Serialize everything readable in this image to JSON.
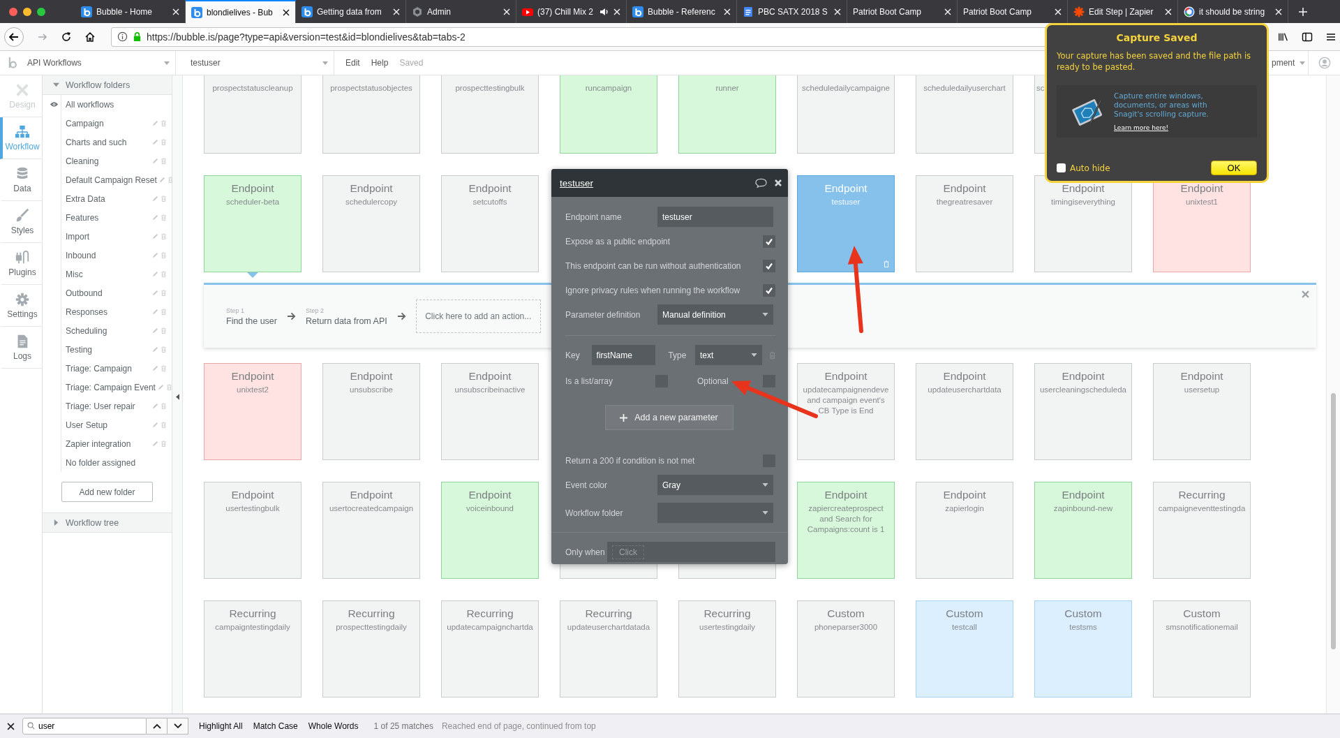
{
  "tabs": [
    {
      "title": "Bubble - Home",
      "selected": false,
      "audio": false
    },
    {
      "title": "blondielives - Bub",
      "selected": true,
      "audio": false
    },
    {
      "title": "Getting data from",
      "selected": false,
      "audio": false
    },
    {
      "title": "Admin",
      "selected": false,
      "audio": false
    },
    {
      "title": "(37) Chill Mix 2",
      "selected": false,
      "audio": true
    },
    {
      "title": "Bubble - Referenc",
      "selected": false,
      "audio": false
    },
    {
      "title": "PBC SATX 2018 S",
      "selected": false,
      "audio": false
    },
    {
      "title": "Patriot Boot Camp",
      "selected": false,
      "audio": false
    },
    {
      "title": "Patriot Boot Camp",
      "selected": false,
      "audio": false
    },
    {
      "title": "Edit Step | Zapier",
      "selected": false,
      "audio": false
    },
    {
      "title": "it should be string",
      "selected": false,
      "audio": false
    }
  ],
  "address_bar": {
    "url": "https://bubble.is/page?type=api&version=test&id=blondielives&tab=tabs-2"
  },
  "editor_toolbar": {
    "page_selector": "API Workflows",
    "workflow_selector": "testuser",
    "menu": [
      "Edit",
      "Help"
    ],
    "save_status": "Saved",
    "mode_selector": "pment"
  },
  "sidebar": {
    "items": [
      {
        "label": "Design",
        "selected": false,
        "disabled": true
      },
      {
        "label": "Workflow",
        "selected": true,
        "disabled": false
      },
      {
        "label": "Data",
        "selected": false,
        "disabled": false
      },
      {
        "label": "Styles",
        "selected": false,
        "disabled": false
      },
      {
        "label": "Plugins",
        "selected": false,
        "disabled": false
      },
      {
        "label": "Settings",
        "selected": false,
        "disabled": false
      },
      {
        "label": "Logs",
        "selected": false,
        "disabled": false
      }
    ]
  },
  "folders": {
    "title": "Workflow folders",
    "expanded": true,
    "items": [
      {
        "label": "All workflows",
        "kind": "all"
      },
      {
        "label": "Campaign",
        "kind": "folder"
      },
      {
        "label": "Charts and such",
        "kind": "folder"
      },
      {
        "label": "Cleaning",
        "kind": "folder"
      },
      {
        "label": "Default Campaign Reset",
        "kind": "folder"
      },
      {
        "label": "Extra Data",
        "kind": "folder"
      },
      {
        "label": "Features",
        "kind": "folder"
      },
      {
        "label": "Import",
        "kind": "folder"
      },
      {
        "label": "Inbound",
        "kind": "folder"
      },
      {
        "label": "Misc",
        "kind": "folder"
      },
      {
        "label": "Outbound",
        "kind": "folder"
      },
      {
        "label": "Responses",
        "kind": "folder"
      },
      {
        "label": "Scheduling",
        "kind": "folder"
      },
      {
        "label": "Testing",
        "kind": "folder"
      },
      {
        "label": "Triage: Campaign",
        "kind": "folder"
      },
      {
        "label": "Triage: Campaign Event",
        "kind": "folder"
      },
      {
        "label": "Triage: User repair",
        "kind": "folder"
      },
      {
        "label": "User Setup",
        "kind": "folder"
      },
      {
        "label": "Zapier integration",
        "kind": "folder"
      },
      {
        "label": "No folder assigned",
        "kind": "none"
      }
    ],
    "add_button": "Add new folder",
    "tree": {
      "title": "Workflow tree",
      "expanded": false
    }
  },
  "grid_top": [
    {
      "cards": [
        {
          "name": "prospectstatuscleanup",
          "color": "#f2f3f3",
          "selected": false
        },
        {
          "name": "prospectstatusobjectes",
          "color": "#f2f3f3",
          "selected": false
        },
        {
          "name": "prospecttestingbulk",
          "color": "#f2f3f3",
          "selected": false
        },
        {
          "name": "runcampaign",
          "color": "#d7f8db",
          "selected": false
        },
        {
          "name": "runner",
          "color": "#d7f8db",
          "selected": false
        },
        {
          "name": "scheduledailycampaigne",
          "color": "#f2f3f3",
          "selected": false
        },
        {
          "name": "scheduledailyuserchart",
          "color": "#f2f3f3",
          "selected": false
        },
        {
          "name": "sc",
          "color": "#f2f3f3",
          "selected": false
        }
      ]
    },
    {
      "cards": [
        {
          "type": "Endpoint",
          "name": "scheduler-beta",
          "color": "#d7f8db",
          "selected": false
        },
        {
          "type": "Endpoint",
          "name": "schedulercopy",
          "color": "#f2f3f3",
          "selected": false
        },
        {
          "type": "Endpoint",
          "name": "setcutoffs",
          "color": "#f2f3f3",
          "selected": false
        },
        {
          "type": "Endpoint",
          "name": "testuser",
          "selected": true
        },
        {
          "type": "Endpoint",
          "name": "thegreatresaver",
          "color": "#f2f3f3",
          "selected": false
        },
        {
          "type": "Endpoint",
          "name": "timingiseverything",
          "color": "#f2f3f3",
          "selected": false
        },
        {
          "type": "Endpoint",
          "name": "unixtest1",
          "color": "#ffe3e3",
          "selected": false
        }
      ]
    }
  ],
  "selected_workflow": {
    "steps": [
      {
        "number": "Step 1",
        "action": "Find the user"
      },
      {
        "number": "Step 2",
        "action": "Return data from API"
      }
    ],
    "add_action": "Click here to add an action..."
  },
  "grid_bottom": [
    {
      "cards": [
        {
          "type": "Endpoint",
          "name": "unixtest2",
          "color": "#ffe3e3",
          "selected": false
        },
        {
          "type": "Endpoint",
          "name": "unsubscribe",
          "color": "#f2f3f3",
          "selected": false
        },
        {
          "type": "Endpoint",
          "name": "unsubscribeinactive",
          "color": "#f2f3f3",
          "selected": false
        },
        {
          "type": "Endpoint",
          "name": "updatecampaignendeve",
          "condition_lines": [
            "and campaign event's",
            "CB Type is End"
          ],
          "color": "#f2f3f3",
          "selected": false
        },
        {
          "type": "Endpoint",
          "name": "updateuserchartdata",
          "color": "#f2f3f3",
          "selected": false
        },
        {
          "type": "Endpoint",
          "name": "usercleaningscheduleda",
          "color": "#f2f3f3",
          "selected": false
        },
        {
          "type": "Endpoint",
          "name": "usersetup",
          "color": "#f2f3f3",
          "selected": false
        }
      ]
    },
    {
      "cards": [
        {
          "type": "Endpoint",
          "name": "usertestingbulk",
          "color": "#f2f3f3",
          "selected": false
        },
        {
          "type": "Endpoint",
          "name": "usertocreatedcampaign",
          "color": "#f2f3f3",
          "selected": false
        },
        {
          "type": "Endpoint",
          "name": "voiceinbound",
          "color": "#d7f8db",
          "selected": false
        },
        {
          "color": "#f2f3f3",
          "selected": false
        },
        {
          "color": "#f2f3f3",
          "selected": false
        },
        {
          "type": "Endpoint",
          "name": "zapiercreateprospect",
          "condition_lines": [
            "and Search for",
            "Campaigns:count is 1"
          ],
          "color": "#d7f8db",
          "selected": false
        },
        {
          "type": "Endpoint",
          "name": "zapierlogin",
          "color": "#f2f3f3",
          "selected": false
        },
        {
          "type": "Endpoint",
          "name": "zapinbound-new",
          "color": "#d7f8db",
          "selected": false
        },
        {
          "type": "Recurring",
          "name": "campaigneventtestingda",
          "color": "#f2f3f3",
          "selected": false
        }
      ]
    },
    {
      "cards": [
        {
          "type": "Recurring",
          "name": "campaigntestingdaily",
          "color": "#f2f3f3",
          "selected": false
        },
        {
          "type": "Recurring",
          "name": "prospecttestingdaily",
          "color": "#f2f3f3",
          "selected": false
        },
        {
          "type": "Recurring",
          "name": "updatecampaignchartda",
          "color": "#f2f3f3",
          "selected": false
        },
        {
          "type": "Recurring",
          "name": "updateuserchartdatada",
          "color": "#f2f3f3",
          "selected": false
        },
        {
          "type": "Recurring",
          "name": "usertestingdaily",
          "color": "#f2f3f3",
          "selected": false
        },
        {
          "type": "Custom",
          "name": "phoneparser3000",
          "color": "#f2f3f3",
          "selected": false
        },
        {
          "type": "Custom",
          "name": "testcall",
          "color": "#dcefff",
          "selected": false
        },
        {
          "type": "Custom",
          "name": "testsms",
          "color": "#dcefff",
          "selected": false
        },
        {
          "type": "Custom",
          "name": "smsnotificationemail",
          "color": "#f2f3f3",
          "selected": false
        }
      ]
    }
  ],
  "endpoint_panel": {
    "title": "testuser",
    "fields": [
      {
        "kind": "input",
        "label": "Endpoint name",
        "value": "testuser"
      },
      {
        "kind": "checkbox",
        "label": "Expose as a public endpoint",
        "checked": true
      },
      {
        "kind": "checkbox",
        "label": "This endpoint can be run without authentication",
        "checked": true
      },
      {
        "kind": "checkbox",
        "label": "Ignore privacy rules when running the workflow",
        "checked": true
      },
      {
        "kind": "dropdown",
        "label": "Parameter definition",
        "value": "Manual definition"
      },
      {
        "kind": "parameter",
        "key_label": "Key",
        "key": "firstName",
        "type_label": "Type",
        "type": "text",
        "list_label": "Is a list/array",
        "list": false,
        "optional_label": "Optional",
        "optional": false
      },
      {
        "kind": "button",
        "label": "Add a new parameter"
      },
      {
        "kind": "checkbox",
        "label": "Return a 200 if condition is not met",
        "checked": false
      },
      {
        "kind": "dropdown",
        "label": "Event color",
        "value": "Gray"
      },
      {
        "kind": "dropdown",
        "label": "Workflow folder"
      },
      {
        "kind": "condition",
        "label": "Only when",
        "placeholder": "Click"
      }
    ]
  },
  "snagit_popup": {
    "title": "Capture Saved",
    "message": "Your capture has been saved and the file path is ready to be pasted.",
    "tip": "Capture entire windows, documents, or areas with Snagit's scrolling capture.",
    "link": "Learn more here!",
    "auto_hide": {
      "label": "Auto hide",
      "checked": false
    },
    "ok_button": "OK"
  },
  "find_bar": {
    "query": "user",
    "options": [
      "Highlight All",
      "Match Case",
      "Whole Words"
    ],
    "match_count": "1 of 25 matches",
    "status": "Reached end of page, continued from top"
  }
}
